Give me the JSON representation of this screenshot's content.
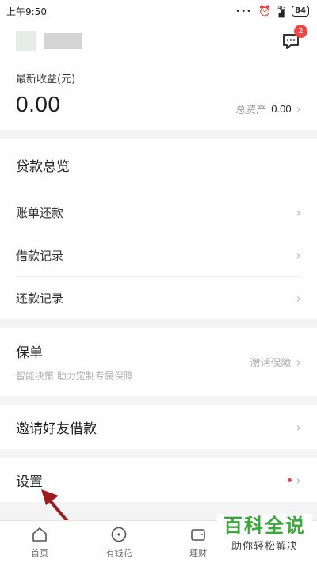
{
  "status": {
    "time": "上午9:50",
    "signal": "4G",
    "battery": "84"
  },
  "header": {
    "badge_count": "2"
  },
  "earnings": {
    "label": "最新收益(元)",
    "value": "0.00",
    "total_label": "总资产",
    "total_value": "0.00"
  },
  "loan": {
    "title": "贷款总览",
    "items": [
      {
        "label": "账单还款"
      },
      {
        "label": "借款记录"
      },
      {
        "label": "还款记录"
      }
    ]
  },
  "policy": {
    "title": "保单",
    "subtitle": "智能决策 助力定制专属保障",
    "action": "激活保障"
  },
  "invite": {
    "label": "邀请好友借款"
  },
  "settings": {
    "label": "设置",
    "dot_color": "#e84848"
  },
  "tabs": [
    {
      "label": "首页",
      "icon": "home-icon"
    },
    {
      "label": "有钱花",
      "icon": "coin-icon"
    },
    {
      "label": "理财",
      "icon": "wallet-icon"
    }
  ],
  "watermark": {
    "title": "百科全说",
    "subtitle": "助你轻松解决"
  },
  "colors": {
    "accent_red": "#e84848",
    "watermark_green": "#3aa83a",
    "annotation_arrow": "#a01c1c"
  }
}
